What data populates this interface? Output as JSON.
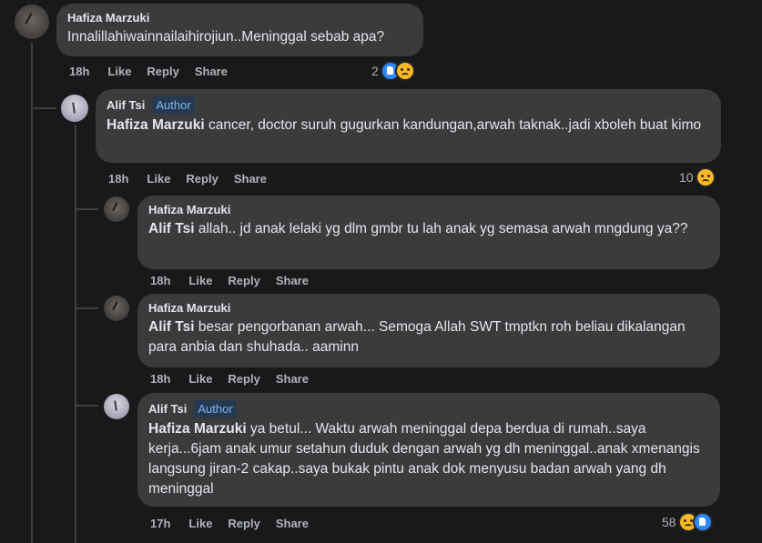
{
  "comments": [
    {
      "author": "Hafiza Marzuki",
      "author_badge": "",
      "text": "Innalillahiwainnailaihirojiun..Meninggal sebab apa?",
      "mention": "",
      "time": "18h",
      "like": "Like",
      "reply": "Reply",
      "share": "Share",
      "reaction_count": "2",
      "reaction_icons": [
        "like-icon",
        "sad-icon"
      ]
    },
    {
      "author": "Alif Tsi",
      "author_badge": "Author",
      "mention": "Hafiza Marzuki",
      "text": " cancer, doctor suruh gugurkan kandungan,arwah taknak..jadi xboleh buat kimo",
      "time": "18h",
      "like": "Like",
      "reply": "Reply",
      "share": "Share",
      "reaction_count": "10",
      "reaction_icons": [
        "sad-icon"
      ]
    },
    {
      "author": "Hafiza Marzuki",
      "author_badge": "",
      "mention": "Alif Tsi",
      "text": " allah.. jd anak lelaki yg dlm gmbr tu lah anak yg semasa arwah mngdung ya??",
      "time": "18h",
      "like": "Like",
      "reply": "Reply",
      "share": "Share",
      "reaction_count": "",
      "reaction_icons": []
    },
    {
      "author": "Hafiza Marzuki",
      "author_badge": "",
      "mention": "Alif Tsi",
      "text": " besar pengorbanan arwah... Semoga Allah SWT tmptkn roh beliau dikalangan para anbia dan shuhada.. aaminn",
      "time": "18h",
      "like": "Like",
      "reply": "Reply",
      "share": "Share",
      "reaction_count": "",
      "reaction_icons": []
    },
    {
      "author": "Alif Tsi",
      "author_badge": "Author",
      "mention": "Hafiza Marzuki",
      "text": " ya betul... Waktu arwah meninggal depa berdua di rumah..saya kerja...6jam anak umur setahun duduk dengan arwah yg dh meninggal..anak xmenangis langsung jiran-2 cakap..saya bukak pintu anak dok menyusu badan arwah yang dh meninggal",
      "time": "17h",
      "like": "Like",
      "reply": "Reply",
      "share": "Share",
      "reaction_count": "58",
      "reaction_icons": [
        "sad-icon",
        "like-icon"
      ]
    }
  ],
  "colors": {
    "background": "#18191a",
    "bubble": "#3a3b3c",
    "author_badge_bg": "#263951",
    "author_badge_text": "#7fb3f0",
    "like_blue": "#2d88ff",
    "sad_yellow": "#f7b928"
  }
}
